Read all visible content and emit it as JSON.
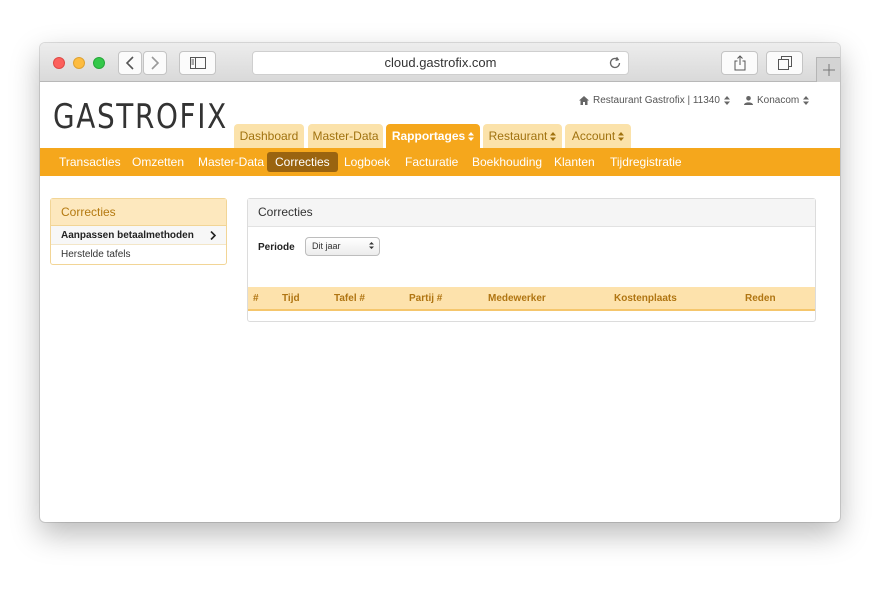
{
  "browser": {
    "url": "cloud.gastrofix.com"
  },
  "header": {
    "logo": "GASTROFIX",
    "restaurant": "Restaurant Gastrofix | 11340",
    "user": "Konacom"
  },
  "main_tabs": [
    {
      "label": "Dashboard"
    },
    {
      "label": "Master-Data"
    },
    {
      "label": "Rapportages"
    },
    {
      "label": "Restaurant"
    },
    {
      "label": "Account"
    }
  ],
  "sub_nav": [
    {
      "label": "Transacties"
    },
    {
      "label": "Omzetten"
    },
    {
      "label": "Master-Data"
    },
    {
      "label": "Correcties"
    },
    {
      "label": "Logboek"
    },
    {
      "label": "Facturatie"
    },
    {
      "label": "Boekhouding"
    },
    {
      "label": "Klanten"
    },
    {
      "label": "Tijdregistratie"
    }
  ],
  "sidebar": {
    "title": "Correcties",
    "items": [
      {
        "label": "Aanpassen betaalmethoden"
      },
      {
        "label": "Herstelde tafels"
      }
    ]
  },
  "panel": {
    "title": "Correcties",
    "period_label": "Periode",
    "period_value": "Dit jaar",
    "columns": [
      "#",
      "Tijd",
      "Tafel #",
      "Partij #",
      "Medewerker",
      "Kostenplaats",
      "Reden"
    ]
  },
  "colors": {
    "accent": "#f5a71c",
    "accent_dark": "#9a6410",
    "tab_inactive": "#fbe2aa",
    "table_header": "#fde2ac"
  }
}
